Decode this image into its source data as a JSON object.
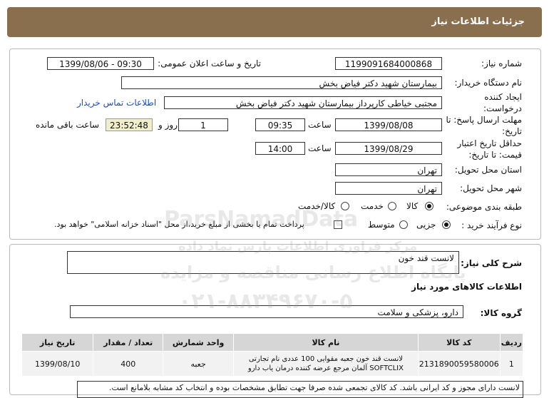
{
  "header": {
    "title": "جزئیات اطلاعات نیاز"
  },
  "info": {
    "need_number_label": "شماره نیاز:",
    "need_number": "1199091684000868",
    "announce_label": "تاریخ و ساعت اعلان عمومی:",
    "announce_value": "1399/08/06 - 09:30",
    "buyer_label": "نام دستگاه خریدار:",
    "buyer_value": "بیمارستان شهید دکتر فیاض بخش",
    "creator_label": "ایجاد کننده درخواست:",
    "creator_value": "مجتبی خیاطی کارپرداز بیمارستان شهید دکتر فیاض بخش",
    "contact_link": "اطلاعات تماس خریدار",
    "reply_deadline_label": "مهلت ارسال پاسخ: تا تاریخ:",
    "reply_date": "1399/08/08",
    "time_label": "ساعت",
    "reply_time": "09:35",
    "days_value": "1",
    "days_label": "روز و",
    "remaining_time": "23:52:48",
    "remaining_label": "ساعت باقی مانده",
    "price_validity_label": "حداقل تاریخ اعتبار قیمت: تا تاریخ:",
    "validity_date": "1399/08/29",
    "validity_time": "14:00",
    "province_label": "استان محل تحویل:",
    "province_value": "تهران",
    "city_label": "شهر محل تحویل:",
    "city_value": "تهران",
    "category_label": "طبقه بندی موضوعی:",
    "category_options": [
      "کالا",
      "خدمت",
      "کالا/خدمت"
    ],
    "process_label": "نوع فرآیند خرید :",
    "process_options": [
      "جزیی",
      "متوسط"
    ],
    "payment_note": "پرداخت تمام یا بخشی از مبلغ خرید،از محل \"اسناد خزانه اسلامی\" خواهد بود."
  },
  "description": {
    "general_label": "شرح کلی نیاز:",
    "general_value": "لانست قند خون",
    "goods_info_title": "اطلاعات کالاهای مورد نیاز",
    "group_label": "گروه کالا:",
    "group_value": "دارو، پزشکی و سلامت"
  },
  "table": {
    "headers": [
      "ردیف",
      "کد کالا",
      "نام کالا",
      "واحد شمارش",
      "تعداد / مقدار",
      "تاریخ نیاز"
    ],
    "rows": [
      [
        "1",
        "2131890059580006",
        "لانست قند خون جعبه مقوایی 100 عددی نام تجارتی SOFTCLIX آلمان مرجع عرضه کننده درمان یاب دارو",
        "جعبه",
        "400",
        "1399/08/10"
      ]
    ]
  },
  "footer_note": "لانست دارای مجوز و کد ایرانی باشد. کد کالای تجمعی شده صرفا جهت تطابق مشخصات بوده و انتخاب کد مشابه بلامانع است.",
  "watermark": {
    "brand": "ParsNamadData",
    "line1": "مرکز فراوری اطلاعات پارس نماد داده",
    "line2": "پایگاه اطلاع رسانی مناقصه و مزایده",
    "phone": "۰۲۱-۸۸۳۴۹۶۷۰-۵"
  }
}
